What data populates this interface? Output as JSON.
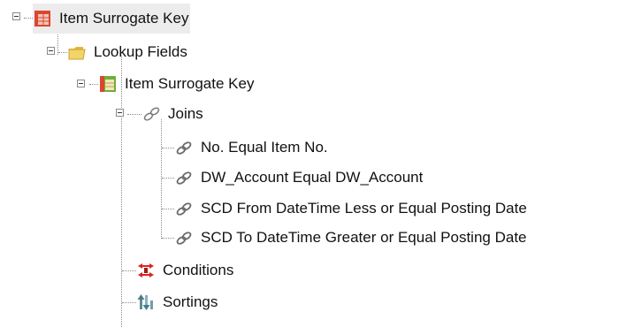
{
  "tree": {
    "root": {
      "label": "Item Surrogate Key",
      "icon": "table-icon",
      "expanded": true,
      "children": {
        "lookup_fields": {
          "label": "Lookup Fields",
          "icon": "folder-icon",
          "expanded": true,
          "children": {
            "item_surrogate_key": {
              "label": "Item Surrogate Key",
              "icon": "table-icon",
              "expanded": true,
              "children": {
                "joins": {
                  "label": "Joins",
                  "icon": "joins-icon",
                  "expanded": true,
                  "items": [
                    {
                      "label": "No. Equal Item No.",
                      "icon": "join-link-icon"
                    },
                    {
                      "label": "DW_Account Equal DW_Account",
                      "icon": "join-link-icon"
                    },
                    {
                      "label": "SCD From DateTime Less or Equal Posting Date",
                      "icon": "join-link-icon"
                    },
                    {
                      "label": "SCD To DateTime Greater or Equal Posting Date",
                      "icon": "join-link-icon"
                    }
                  ]
                }
              }
            }
          }
        },
        "conditions": {
          "label": "Conditions",
          "icon": "conditions-icon"
        },
        "sortings": {
          "label": "Sortings",
          "icon": "sortings-icon"
        }
      }
    }
  },
  "colors": {
    "selection_background": "#ececec",
    "tree_line": "#8a8a8a",
    "table_icon_red": "#d9482e",
    "table_icon_green": "#6fae3a",
    "folder_yellow": "#f2d46b",
    "conditions_red": "#d8261c"
  }
}
